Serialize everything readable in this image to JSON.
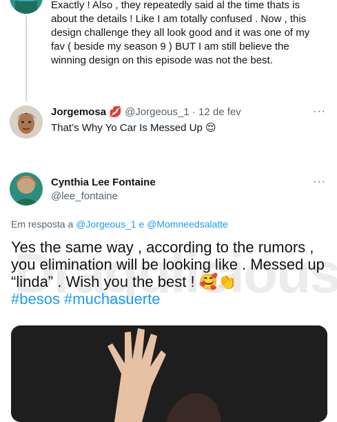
{
  "thread": {
    "previous_reply": {
      "text": "Exactly ! Also , they repeatedly said al the time thats is about the details ! Like I am totally confused . Now , this design challenge they all look good and it was one of my fav ( beside my  season 9 ) BUT I am still believe the winning design on this episode was not the best."
    },
    "reply2": {
      "name": "Jorgemosa",
      "name_emoji": "💋",
      "handle": "@Jorgeous_1",
      "separator": "·",
      "date": "12 de fev",
      "text": "That’s Why Yo Car Is Messed Up",
      "text_emoji": "😌"
    },
    "main_tweet": {
      "name": "Cynthia Lee Fontaine",
      "handle": "@lee_fontaine",
      "reply_prefix": "Em resposta a",
      "reply_handle_1": "@Jorgeous_1",
      "reply_joiner": "e",
      "reply_handle_2": "@Momneedsalatte",
      "text": "Yes the same way , according to the rumors , you elimination will be looking like . Messed up “linda” .  Wish you the best !",
      "text_emoji": "🥰👏",
      "hashtags": "#besos #muchasuerte",
      "watermark": "Dragulicious"
    },
    "more_icon": "···"
  },
  "colors": {
    "link": "#1d9bf0",
    "secondary_text": "#536471",
    "thread_line": "#cfd9de"
  }
}
